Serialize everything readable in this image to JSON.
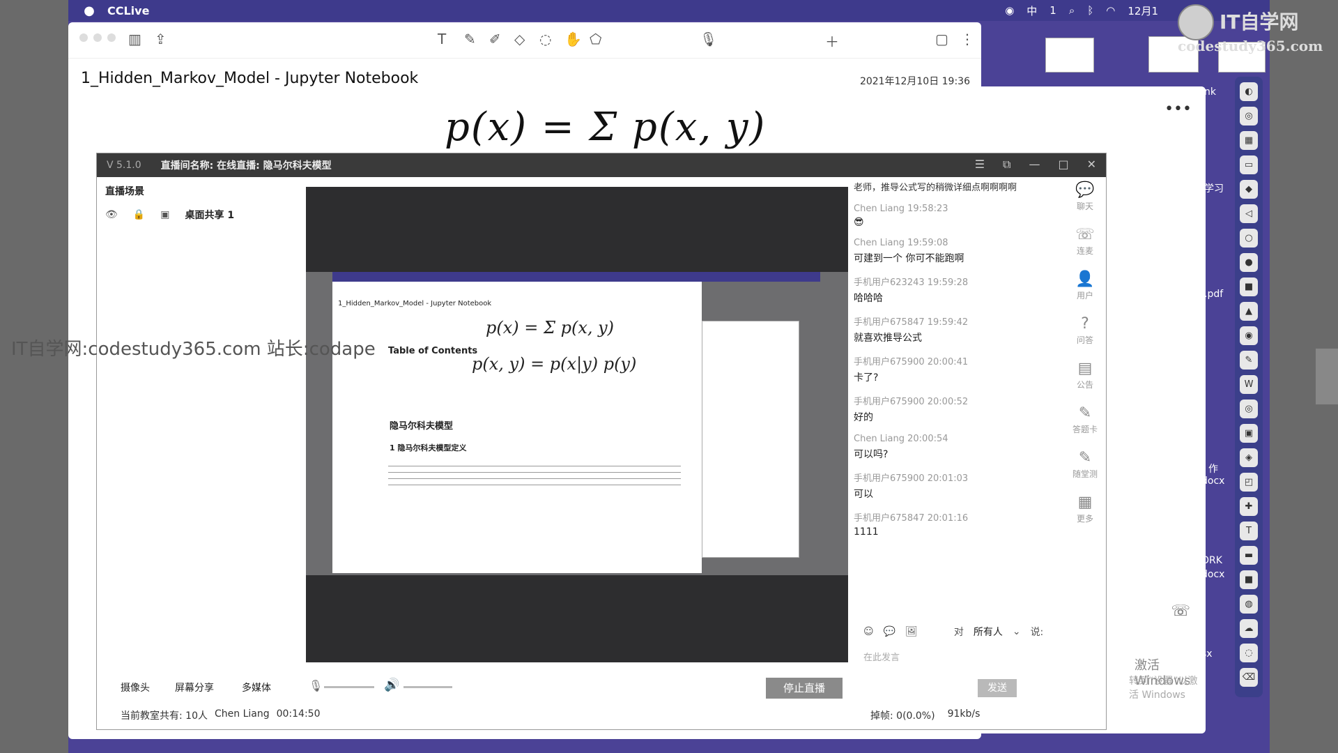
{
  "menubar": {
    "apple": "",
    "app_name": "CCLive",
    "tray": [
      "中",
      "1",
      "12月1"
    ]
  },
  "watermark": {
    "site": "IT自学网",
    "domain": "codestudy365.com",
    "overlay_text": "IT自学网:codestudy365.com 站长:codape"
  },
  "notes": {
    "title": "1_Hidden_Markov_Model - Jupyter Notebook",
    "date": "2021年12月10日 19:36",
    "formula": "p(x) = Σ p(x, y)"
  },
  "desktop_labels": [
    "nk",
    "学习",
    ".pdf",
    "作",
    "docx",
    "ORK",
    "docx",
    "sx"
  ],
  "behind": {
    "activate_1": "激活 Windows",
    "activate_2": "转到“设置”以激活 Windows"
  },
  "live": {
    "version": "V 5.1.0",
    "room_name": "直播间名称: 在线直播: 隐马尔科夫模型",
    "scene_title": "直播场景",
    "scene_item": "桌面共享 1",
    "buttons": {
      "camera": "摄像头",
      "screen_share": "屏幕分享",
      "media": "多媒体",
      "stop": "停止直播",
      "send": "发送"
    },
    "status": {
      "room_count": "当前教室共有: 10人",
      "host": "Chen Liang",
      "duration": "00:14:50",
      "dropped": "掉帧: 0(0.0%)",
      "bitrate": "91kb/s"
    },
    "preview": {
      "title": "1_Hidden_Markov_Model - Jupyter Notebook",
      "formula_1": "p(x) = Σ p(x, y)",
      "formula_2": "p(x, y) = p(x|y) p(y)",
      "toc": "Table of Contents",
      "h1": "隐马尔科夫模型",
      "h2": "1 隐马尔科夫模型定义"
    }
  },
  "chat": {
    "top_msg": "老师，推导公式写的稍微详细点啊啊啊啊",
    "messages": [
      {
        "who": "Chen Liang 19:58:23",
        "text": "😎"
      },
      {
        "who": "Chen Liang 19:59:08",
        "text": "可建到一个  你可不能跑啊"
      },
      {
        "who": "手机用户623243 19:59:28",
        "text": "哈哈哈"
      },
      {
        "who": "手机用户675847 19:59:42",
        "text": "就喜欢推导公式"
      },
      {
        "who": "手机用户675900 20:00:41",
        "text": "卡了?"
      },
      {
        "who": "手机用户675900 20:00:52",
        "text": "好的"
      },
      {
        "who": "Chen Liang 20:00:54",
        "text": "可以吗?"
      },
      {
        "who": "手机用户675900 20:01:03",
        "text": "可以"
      },
      {
        "who": "手机用户675847 20:01:16",
        "text": "1111"
      }
    ],
    "rail": [
      "聊天",
      "连麦",
      "用户",
      "问答",
      "公告",
      "答题卡",
      "随堂测",
      "更多"
    ],
    "to_label": "对",
    "audience": "所有人",
    "say": "说:",
    "input_placeholder": "在此发言"
  }
}
